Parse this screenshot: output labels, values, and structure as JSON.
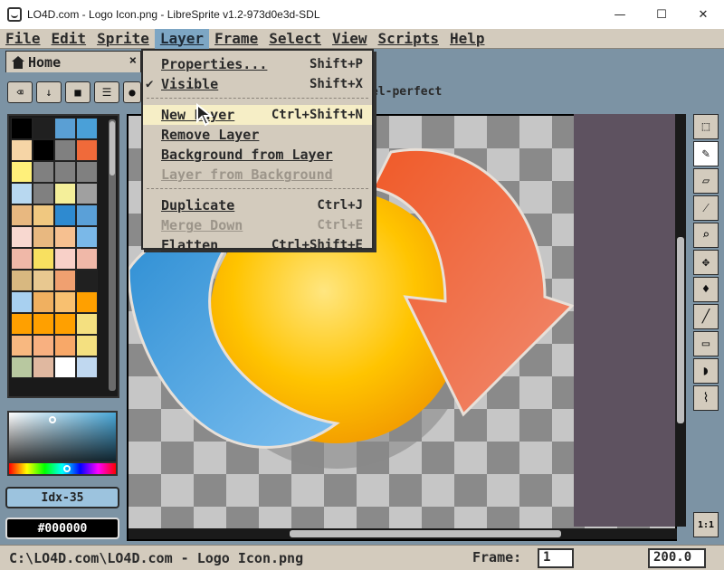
{
  "window": {
    "title": "LO4D.com - Logo Icon.png - LibreSprite v1.2-973d0e3d-SDL",
    "minimize": "—",
    "maximize": "☐",
    "close": "✕"
  },
  "menubar": {
    "items": [
      "File",
      "Edit",
      "Sprite",
      "Layer",
      "Frame",
      "Select",
      "View",
      "Scripts",
      "Help"
    ],
    "active": "Layer"
  },
  "tab": {
    "label": "Home",
    "close": "×"
  },
  "toolbar": {
    "hint": "el-perfect"
  },
  "layer_menu": {
    "items": [
      {
        "label": "Properties...",
        "shortcut": "Shift+P"
      },
      {
        "label": "Visible",
        "shortcut": "Shift+X",
        "checked": true
      },
      {
        "label": "New Layer",
        "shortcut": "Ctrl+Shift+N",
        "highlighted": true
      },
      {
        "label": "Remove Layer",
        "shortcut": ""
      },
      {
        "label": "Background from Layer",
        "shortcut": ""
      },
      {
        "label": "Layer from Background",
        "shortcut": "",
        "disabled": true
      },
      {
        "label": "Duplicate",
        "shortcut": "Ctrl+J"
      },
      {
        "label": "Merge Down",
        "shortcut": "Ctrl+E",
        "disabled": true
      },
      {
        "label": "Flatten",
        "shortcut": "Ctrl+Shift+E"
      }
    ]
  },
  "color_panel": {
    "index_label": "Idx-35",
    "hex_label": "#000000"
  },
  "status": {
    "path": "C:\\LO4D.com\\LO4D.com - Logo Icon.png",
    "frame_label": "Frame:",
    "frame_value": "1",
    "zoom_value": "200.0"
  },
  "zoom_button": "1:1",
  "colors": {
    "accent_menu": "#7da6c4",
    "panel_bg": "#d3cbbd",
    "workspace_bg": "#7c93a4",
    "arrow_blue": "#2f8fd4",
    "arrow_orange": "#ee5a2e",
    "sphere_yellow": "#ffc400"
  },
  "palette_colors": [
    "#000000",
    "#202020",
    "#5a9fd4",
    "#4aa0d8",
    "#f6d5a6",
    "#000000",
    "#808080",
    "#f06a3a",
    "#fff07a",
    "#808080",
    "#808080",
    "#808080",
    "#b8d8f0",
    "#808080",
    "#f4ef9a",
    "#a0a0a0",
    "#e8b880",
    "#f0c880",
    "#2e8ad0",
    "#5aa0d8",
    "#f8d8d0",
    "#e8b880",
    "#f6c090",
    "#7ab8e8",
    "#f0b8a8",
    "#f8e060",
    "#f8d0c8",
    "#f0b8a8",
    "#d8b880",
    "#e8c890",
    "#f0a070",
    "#202020",
    "#a8d0f0",
    "#f0b060",
    "#f8c070",
    "#ffa000",
    "#ffa000",
    "#ffa000",
    "#ffa000",
    "#f4e080",
    "#f8b880",
    "#f8b080",
    "#f8a868",
    "#f4e080",
    "#b8c8a0",
    "#e0b8a0",
    "#ffffff",
    "#c0d8f0"
  ]
}
